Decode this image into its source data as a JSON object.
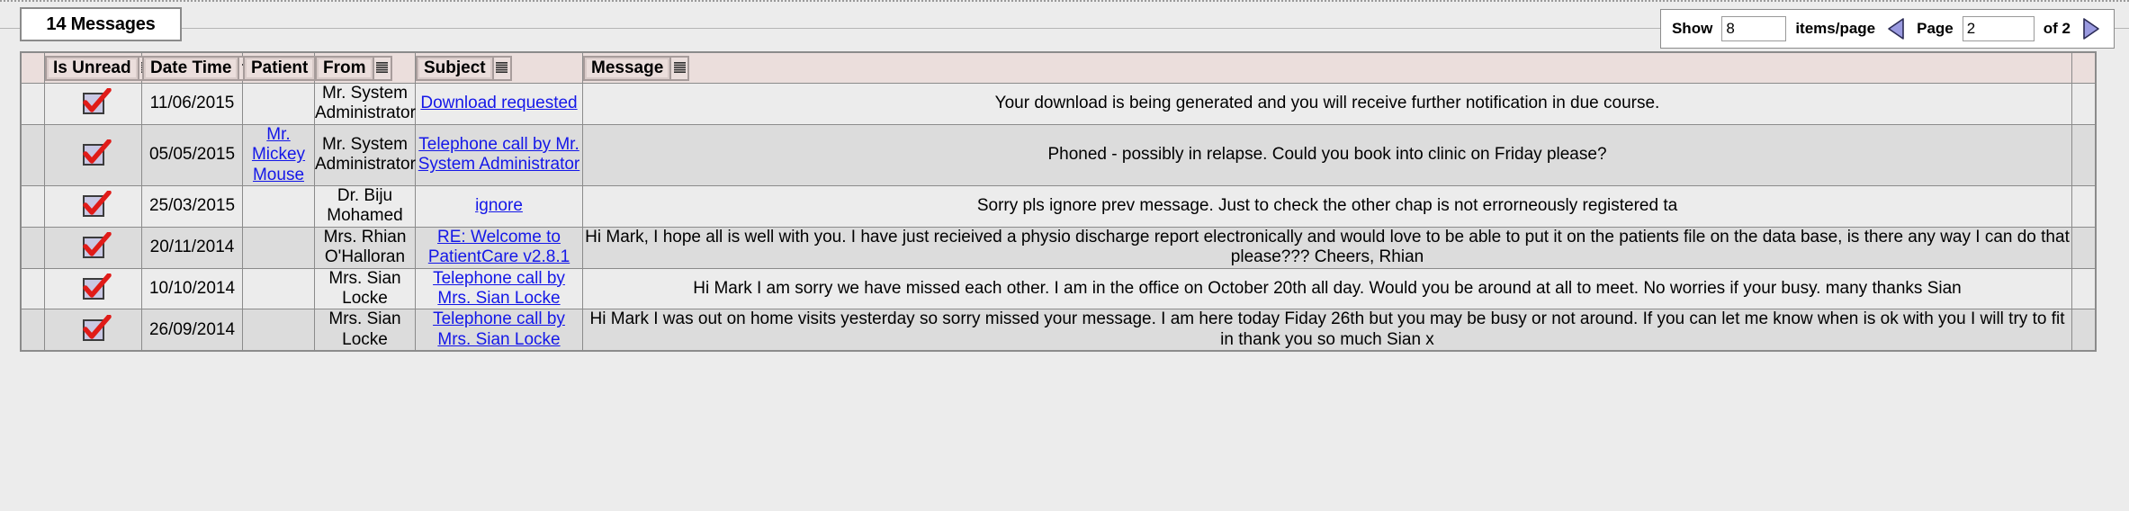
{
  "tab": {
    "label": "14 Messages"
  },
  "pager": {
    "show_label": "Show",
    "items_value": "8",
    "items_label": "items/page",
    "prev_icon": "triangle-left-icon",
    "page_label": "Page",
    "page_value": "2",
    "of_label": "of 2",
    "next_icon": "triangle-right-icon",
    "accent": "#9a9ae0"
  },
  "grid": {
    "columns": [
      {
        "key": "is_unread",
        "label": "Is Unread",
        "menu_icon": "column-menu-icon"
      },
      {
        "key": "date_time",
        "label": "Date Time",
        "menu_icon": "column-sort-icon"
      },
      {
        "key": "patient",
        "label": "Patient",
        "menu_icon": "column-menu-icon"
      },
      {
        "key": "from",
        "label": "From",
        "menu_icon": "column-menu-icon"
      },
      {
        "key": "subject",
        "label": "Subject",
        "menu_icon": "column-menu-icon"
      },
      {
        "key": "message",
        "label": "Message",
        "menu_icon": "column-menu-icon"
      }
    ],
    "header_bg": "#ebdedc",
    "row_bg_odd": "#ececec",
    "row_bg_even": "#dcdcdc",
    "link_color": "#1417e8",
    "rows": [
      {
        "is_unread": true,
        "date_time": "11/06/2015",
        "patient": "",
        "from": "Mr. System Administrator",
        "subject": "Download requested",
        "message": "Your download is being generated and you will receive further notification in due course."
      },
      {
        "is_unread": true,
        "date_time": "05/05/2015",
        "patient": "Mr. Mickey Mouse",
        "from": "Mr. System Administrator",
        "subject": "Telephone call by Mr. System Administrator",
        "message": "Phoned - possibly in relapse. Could you book into clinic on Friday please?"
      },
      {
        "is_unread": true,
        "date_time": "25/03/2015",
        "patient": "",
        "from": "Dr. Biju Mohamed",
        "subject": "ignore",
        "message": "Sorry pls ignore prev message. Just to check the other chap is not errorneously registered ta"
      },
      {
        "is_unread": true,
        "date_time": "20/11/2014",
        "patient": "",
        "from": "Mrs. Rhian O'Halloran",
        "subject": "RE: Welcome to PatientCare v2.8.1",
        "message": "Hi Mark, I hope all is well with you. I have just recieived a physio discharge report electronically and would love to be able to put it on the patients file on the data base, is there any way I can do that please??? Cheers, Rhian"
      },
      {
        "is_unread": true,
        "date_time": "10/10/2014",
        "patient": "",
        "from": "Mrs. Sian Locke",
        "subject": "Telephone call by Mrs. Sian Locke",
        "message": "Hi Mark I am sorry we have missed each other. I am in the office on October 20th all day. Would you be around at all to meet. No worries if your busy. many thanks Sian"
      },
      {
        "is_unread": true,
        "date_time": "26/09/2014",
        "patient": "",
        "from": "Mrs. Sian Locke",
        "subject": "Telephone call by Mrs. Sian Locke",
        "message": "Hi Mark I was out on home visits yesterday so sorry missed your message. I am here today Fiday 26th but you may be busy or not around. If you can let me know when is ok with you I will try to fit in thank you so much Sian x"
      }
    ]
  }
}
